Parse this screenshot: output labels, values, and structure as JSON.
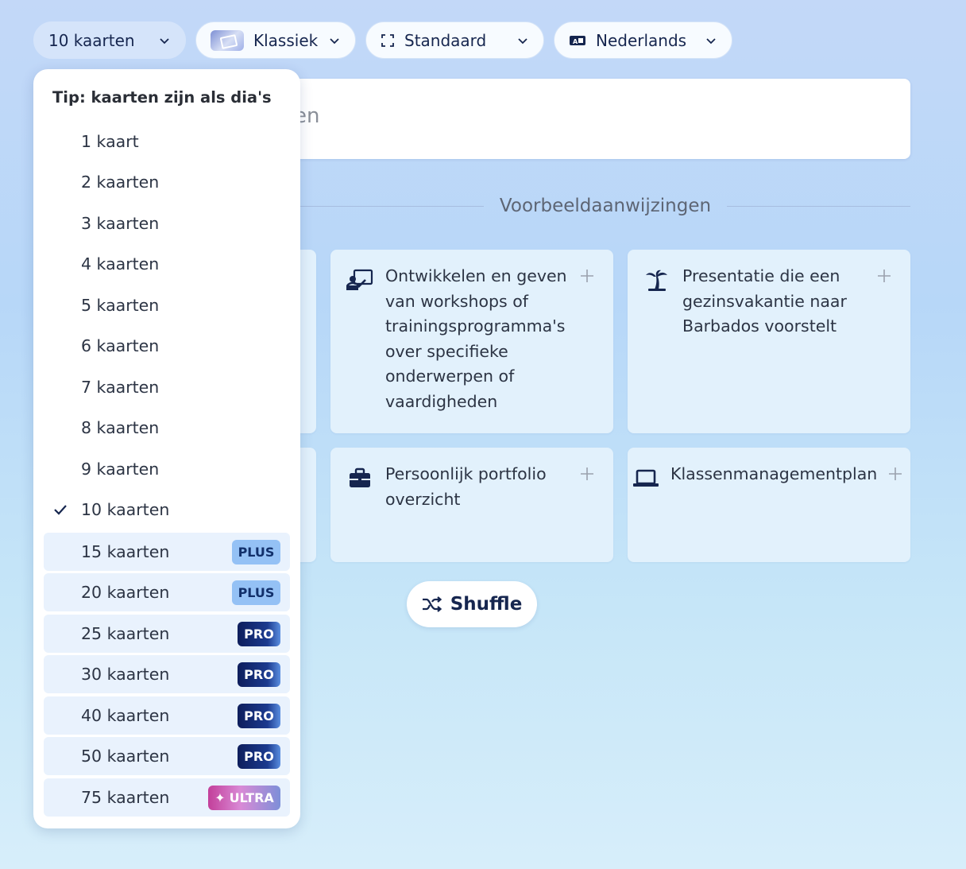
{
  "toolbar": {
    "cards": {
      "label": "10 kaarten"
    },
    "theme": {
      "label": "Klassiek"
    },
    "format": {
      "label": "Standaard"
    },
    "language": {
      "label": "Nederlands"
    }
  },
  "prompt": {
    "visible_fragment": "en"
  },
  "examples": {
    "heading": "Voorbeeldaanwijzingen",
    "cards": [
      {
        "icon": "presentation-person-icon",
        "text": "Ontwikkelen en geven van workshops of trainingsprogramma's over specifieke onderwerpen of vaardigheden"
      },
      {
        "icon": "palm-tree-icon",
        "text": "Presentatie die een gezinsvakantie naar Barbados voorstelt"
      },
      {
        "icon": "briefcase-icon",
        "text": "Persoonlijk portfolio overzicht"
      },
      {
        "icon": "laptop-icon",
        "text": "Klassenmanagementplan"
      }
    ]
  },
  "shuffle": {
    "label": "Shuffle"
  },
  "dropdown": {
    "tip": "Tip: kaarten zijn als dia's",
    "options": [
      {
        "label": "1 kaart",
        "badge": ""
      },
      {
        "label": "2 kaarten",
        "badge": ""
      },
      {
        "label": "3 kaarten",
        "badge": ""
      },
      {
        "label": "4 kaarten",
        "badge": ""
      },
      {
        "label": "5 kaarten",
        "badge": ""
      },
      {
        "label": "6 kaarten",
        "badge": ""
      },
      {
        "label": "7 kaarten",
        "badge": ""
      },
      {
        "label": "8 kaarten",
        "badge": ""
      },
      {
        "label": "9 kaarten",
        "badge": ""
      },
      {
        "label": "10 kaarten",
        "badge": "",
        "selected": true
      },
      {
        "label": "15 kaarten",
        "badge": "PLUS"
      },
      {
        "label": "20 kaarten",
        "badge": "PLUS"
      },
      {
        "label": "25 kaarten",
        "badge": "PRO"
      },
      {
        "label": "30 kaarten",
        "badge": "PRO"
      },
      {
        "label": "40 kaarten",
        "badge": "PRO"
      },
      {
        "label": "50 kaarten",
        "badge": "PRO"
      },
      {
        "label": "75 kaarten",
        "badge": "ULTRA"
      }
    ],
    "ultra_glyph": "✦"
  },
  "colors": {
    "accent_dark": "#16264f",
    "plus_badge": "#94c1f5",
    "pro_badge": "#0e1e5c",
    "ultra_badge": "#c33f9a"
  }
}
